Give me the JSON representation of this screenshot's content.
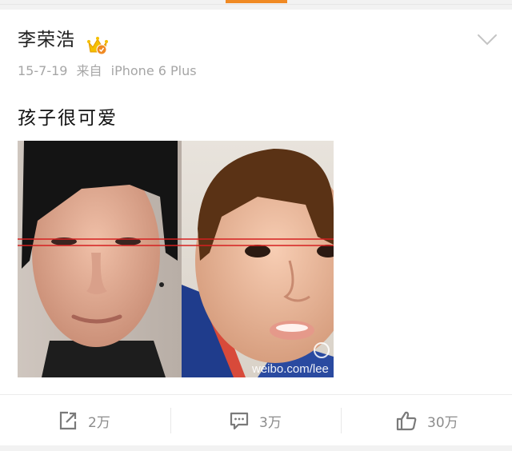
{
  "header": {
    "active_tab": "feed"
  },
  "post": {
    "author": "李荣浩",
    "badge_icon": "vip-crown-icon",
    "date": "15-7-19",
    "source_prefix": "来自",
    "source": "iPhone 6 Plus",
    "text": "孩子很可爱",
    "image": {
      "watermark": "weibo.com/lee",
      "content": "side-by-side comparison of a man's face and a child's face with red eye-level lines"
    }
  },
  "actions": {
    "repost": {
      "icon": "repost-icon",
      "count": "2万"
    },
    "comment": {
      "icon": "comment-icon",
      "count": "3万"
    },
    "like": {
      "icon": "thumbs-up-icon",
      "count": "30万"
    }
  },
  "colors": {
    "accent": "#f08a24",
    "meta_text": "#a6a6a6",
    "guide_line": "#d62020"
  }
}
